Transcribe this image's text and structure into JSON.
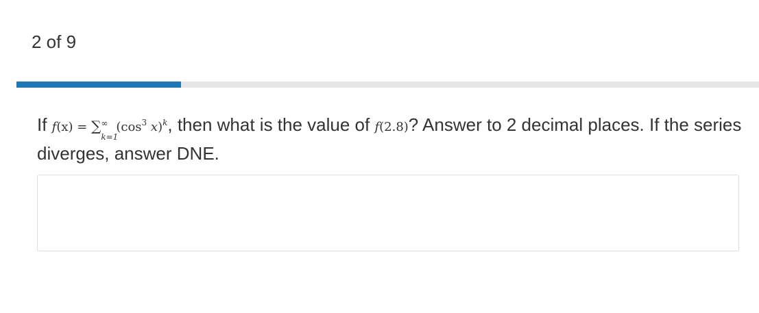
{
  "header": {
    "counter_label": "2 of 9"
  },
  "progress": {
    "fraction": 0.222,
    "fill_color": "#1f78b4",
    "track_color": "#e6e6e6"
  },
  "question": {
    "lead": "If ",
    "math_f": "f",
    "math_x_arg": "(x)",
    "math_eq": " = ",
    "math_sigma": "∑",
    "math_sum_upper": "∞",
    "math_sum_lower": "k=1",
    "math_paren_open": "(",
    "math_cos": "cos",
    "math_cos_exp": "3",
    "math_x": " x",
    "math_paren_close": ")",
    "math_power": "k",
    "after_expr": ", then what is the value of ",
    "eval_f": "f",
    "eval_arg": "(2.8)",
    "trailing": "? Answer to 2 decimal places. If the series diverges, answer DNE."
  },
  "answer": {
    "value": "",
    "placeholder": ""
  }
}
